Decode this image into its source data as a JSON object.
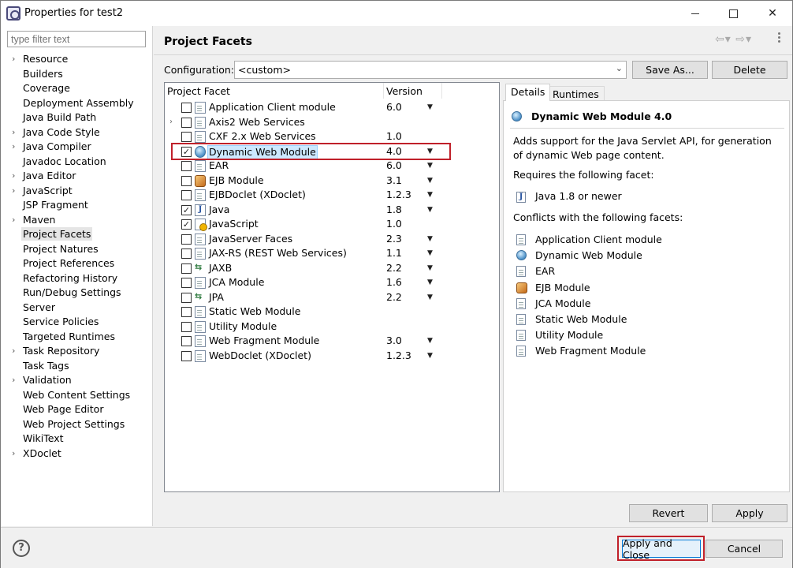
{
  "window": {
    "title": "Properties for test2"
  },
  "filter": {
    "placeholder": "type filter text"
  },
  "nav": {
    "items": [
      {
        "label": "Resource",
        "expandable": true
      },
      {
        "label": "Builders",
        "expandable": false
      },
      {
        "label": "Coverage",
        "expandable": false
      },
      {
        "label": "Deployment Assembly",
        "expandable": false
      },
      {
        "label": "Java Build Path",
        "expandable": false
      },
      {
        "label": "Java Code Style",
        "expandable": true
      },
      {
        "label": "Java Compiler",
        "expandable": true
      },
      {
        "label": "Javadoc Location",
        "expandable": false
      },
      {
        "label": "Java Editor",
        "expandable": true
      },
      {
        "label": "JavaScript",
        "expandable": true
      },
      {
        "label": "JSP Fragment",
        "expandable": false
      },
      {
        "label": "Maven",
        "expandable": true
      },
      {
        "label": "Project Facets",
        "expandable": false,
        "selected": true
      },
      {
        "label": "Project Natures",
        "expandable": false
      },
      {
        "label": "Project References",
        "expandable": false
      },
      {
        "label": "Refactoring History",
        "expandable": false
      },
      {
        "label": "Run/Debug Settings",
        "expandable": false
      },
      {
        "label": "Server",
        "expandable": false
      },
      {
        "label": "Service Policies",
        "expandable": false
      },
      {
        "label": "Targeted Runtimes",
        "expandable": false
      },
      {
        "label": "Task Repository",
        "expandable": true
      },
      {
        "label": "Task Tags",
        "expandable": false
      },
      {
        "label": "Validation",
        "expandable": true
      },
      {
        "label": "Web Content Settings",
        "expandable": false
      },
      {
        "label": "Web Page Editor",
        "expandable": false
      },
      {
        "label": "Web Project Settings",
        "expandable": false
      },
      {
        "label": "WikiText",
        "expandable": false
      },
      {
        "label": "XDoclet",
        "expandable": true
      }
    ]
  },
  "page": {
    "title": "Project Facets"
  },
  "config": {
    "label": "Configuration:",
    "value": "<custom>",
    "save_as": "Save As...",
    "delete": "Delete"
  },
  "table": {
    "col_facet": "Project Facet",
    "col_version": "Version",
    "rows": [
      {
        "name": "Application Client module",
        "version": "6.0",
        "checked": false,
        "icon": "doc",
        "dropdown": true,
        "expandable": false
      },
      {
        "name": "Axis2 Web Services",
        "version": "",
        "checked": false,
        "icon": "doc",
        "dropdown": false,
        "expandable": true
      },
      {
        "name": "CXF 2.x Web Services",
        "version": "1.0",
        "checked": false,
        "icon": "doc",
        "dropdown": false,
        "expandable": false
      },
      {
        "name": "Dynamic Web Module",
        "version": "4.0",
        "checked": true,
        "icon": "globe",
        "dropdown": true,
        "expandable": false,
        "highlighted": true
      },
      {
        "name": "EAR",
        "version": "6.0",
        "checked": false,
        "icon": "doc",
        "dropdown": true,
        "expandable": false
      },
      {
        "name": "EJB Module",
        "version": "3.1",
        "checked": false,
        "icon": "ejb",
        "dropdown": true,
        "expandable": false
      },
      {
        "name": "EJBDoclet (XDoclet)",
        "version": "1.2.3",
        "checked": false,
        "icon": "doc",
        "dropdown": true,
        "expandable": false
      },
      {
        "name": "Java",
        "version": "1.8",
        "checked": true,
        "icon": "java",
        "dropdown": true,
        "expandable": false
      },
      {
        "name": "JavaScript",
        "version": "1.0",
        "checked": true,
        "icon": "js",
        "dropdown": false,
        "expandable": false
      },
      {
        "name": "JavaServer Faces",
        "version": "2.3",
        "checked": false,
        "icon": "doc",
        "dropdown": true,
        "expandable": false
      },
      {
        "name": "JAX-RS (REST Web Services)",
        "version": "1.1",
        "checked": false,
        "icon": "doc",
        "dropdown": true,
        "expandable": false
      },
      {
        "name": "JAXB",
        "version": "2.2",
        "checked": false,
        "icon": "arrows",
        "dropdown": true,
        "expandable": false
      },
      {
        "name": "JCA Module",
        "version": "1.6",
        "checked": false,
        "icon": "doc",
        "dropdown": true,
        "expandable": false
      },
      {
        "name": "JPA",
        "version": "2.2",
        "checked": false,
        "icon": "arrows",
        "dropdown": true,
        "expandable": false
      },
      {
        "name": "Static Web Module",
        "version": "",
        "checked": false,
        "icon": "doc",
        "dropdown": false,
        "expandable": false
      },
      {
        "name": "Utility Module",
        "version": "",
        "checked": false,
        "icon": "doc",
        "dropdown": false,
        "expandable": false
      },
      {
        "name": "Web Fragment Module",
        "version": "3.0",
        "checked": false,
        "icon": "doc",
        "dropdown": true,
        "expandable": false
      },
      {
        "name": "WebDoclet (XDoclet)",
        "version": "1.2.3",
        "checked": false,
        "icon": "doc",
        "dropdown": true,
        "expandable": false
      }
    ]
  },
  "details": {
    "tab_details": "Details",
    "tab_runtimes": "Runtimes",
    "title": "Dynamic Web Module 4.0",
    "description": "Adds support for the Java Servlet API, for generation of dynamic Web page content.",
    "requires_label": "Requires the following facet:",
    "requires_item": "Java 1.8 or newer",
    "conflicts_label": "Conflicts with the following facets:",
    "conflicts": [
      {
        "name": "Application Client module",
        "icon": "doc"
      },
      {
        "name": "Dynamic Web Module",
        "icon": "globe"
      },
      {
        "name": "EAR",
        "icon": "doc"
      },
      {
        "name": "EJB Module",
        "icon": "ejb"
      },
      {
        "name": "JCA Module",
        "icon": "doc"
      },
      {
        "name": "Static Web Module",
        "icon": "doc"
      },
      {
        "name": "Utility Module",
        "icon": "doc"
      },
      {
        "name": "Web Fragment Module",
        "icon": "doc"
      }
    ]
  },
  "buttons": {
    "revert": "Revert",
    "apply": "Apply",
    "apply_close": "Apply and Close",
    "cancel": "Cancel",
    "help": "?"
  },
  "colors": {
    "highlight_outline": "#c0202a",
    "selection": "#cce8ff",
    "default_button_border": "#0078d7"
  }
}
